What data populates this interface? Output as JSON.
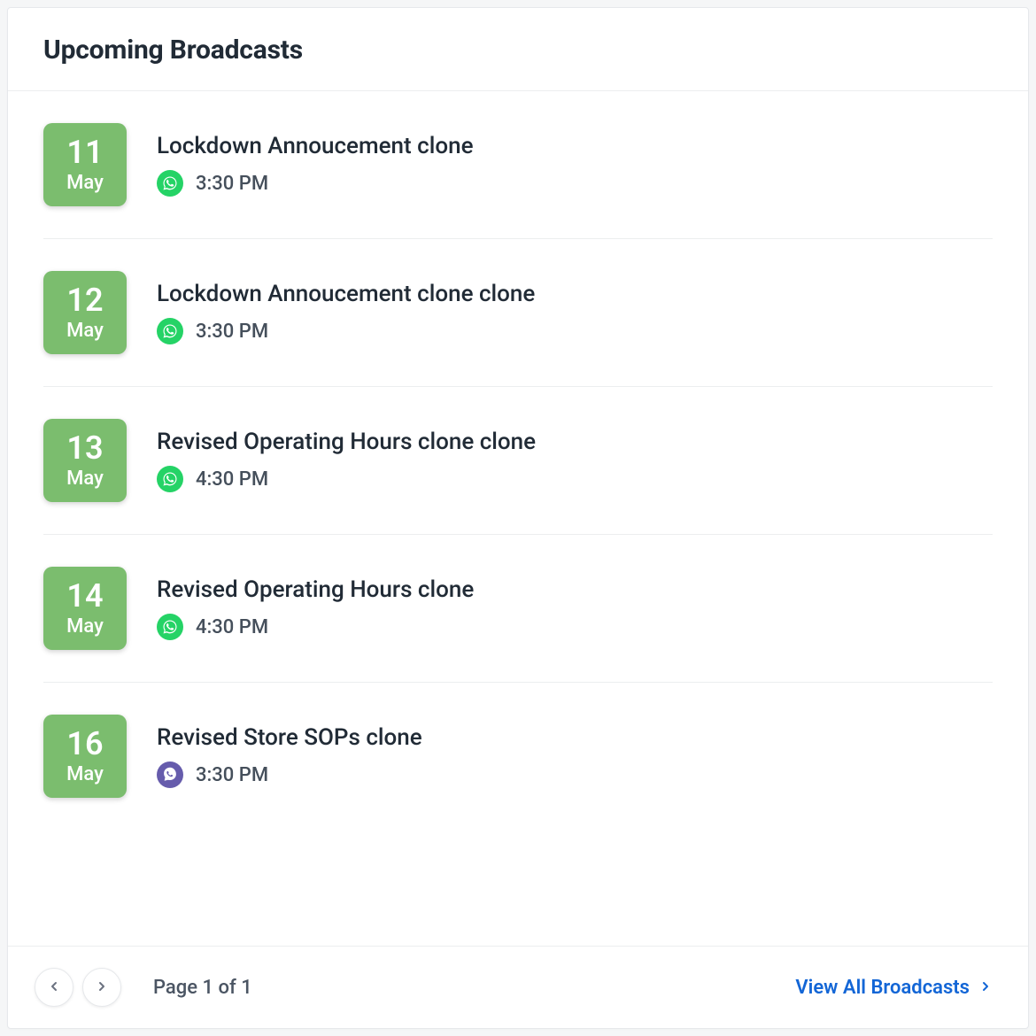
{
  "header": {
    "title": "Upcoming Broadcasts"
  },
  "broadcasts": [
    {
      "day": "11",
      "month": "May",
      "title": "Lockdown Annoucement clone",
      "channel": "whatsapp",
      "time": "3:30 PM"
    },
    {
      "day": "12",
      "month": "May",
      "title": "Lockdown Annoucement clone clone",
      "channel": "whatsapp",
      "time": "3:30 PM"
    },
    {
      "day": "13",
      "month": "May",
      "title": "Revised Operating Hours clone clone",
      "channel": "whatsapp",
      "time": "4:30 PM"
    },
    {
      "day": "14",
      "month": "May",
      "title": "Revised Operating Hours clone",
      "channel": "whatsapp",
      "time": "4:30 PM"
    },
    {
      "day": "16",
      "month": "May",
      "title": "Revised Store SOPs clone",
      "channel": "viber",
      "time": "3:30 PM"
    }
  ],
  "footer": {
    "page_label": "Page 1 of 1",
    "view_all_label": "View All Broadcasts"
  },
  "icons": {
    "whatsapp": "whatsapp-icon",
    "viber": "viber-icon"
  }
}
